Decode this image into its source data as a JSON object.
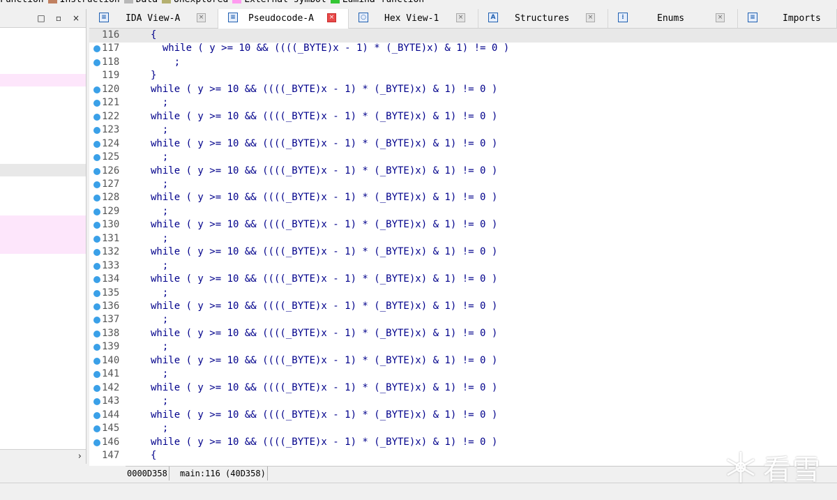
{
  "legend": [
    {
      "label": "Function",
      "color": "#ffffff"
    },
    {
      "label": "Instruction",
      "color": "#c08060"
    },
    {
      "label": "Data",
      "color": "#b8b8b8"
    },
    {
      "label": "Unexplored",
      "color": "#b5b070"
    },
    {
      "label": "External symbol",
      "color": "#ff9bf0"
    },
    {
      "label": "Lumina function",
      "color": "#34c634"
    }
  ],
  "left_panel": {
    "header_buttons": [
      "□",
      "▫",
      "×"
    ],
    "scroll_right": "›"
  },
  "tabs": [
    {
      "label": "IDA View-A",
      "icon": "ida-view-icon",
      "glyph": "≡",
      "active": false
    },
    {
      "label": "Pseudocode-A",
      "icon": "pseudocode-icon",
      "glyph": "≡",
      "active": true
    },
    {
      "label": "Hex View-1",
      "icon": "hex-view-icon",
      "glyph": "○",
      "active": false
    },
    {
      "label": "Structures",
      "icon": "structures-icon",
      "glyph": "A",
      "active": false
    },
    {
      "label": "Enums",
      "icon": "enums-icon",
      "glyph": "⁝",
      "active": false
    },
    {
      "label": "Imports",
      "icon": "imports-icon",
      "glyph": "≡",
      "active": false
    }
  ],
  "code_lines": [
    {
      "num": "116",
      "bp": false,
      "text": "{"
    },
    {
      "num": "117",
      "bp": true,
      "text": "  while ( y >= 10 && ((((_BYTE)x - 1) * (_BYTE)x) & 1) != 0 )"
    },
    {
      "num": "118",
      "bp": true,
      "text": "    ;"
    },
    {
      "num": "119",
      "bp": false,
      "text": "}"
    },
    {
      "num": "120",
      "bp": true,
      "text": "while ( y >= 10 && ((((_BYTE)x - 1) * (_BYTE)x) & 1) != 0 )"
    },
    {
      "num": "121",
      "bp": true,
      "text": "  ;"
    },
    {
      "num": "122",
      "bp": true,
      "text": "while ( y >= 10 && ((((_BYTE)x - 1) * (_BYTE)x) & 1) != 0 )"
    },
    {
      "num": "123",
      "bp": true,
      "text": "  ;"
    },
    {
      "num": "124",
      "bp": true,
      "text": "while ( y >= 10 && ((((_BYTE)x - 1) * (_BYTE)x) & 1) != 0 )"
    },
    {
      "num": "125",
      "bp": true,
      "text": "  ;"
    },
    {
      "num": "126",
      "bp": true,
      "text": "while ( y >= 10 && ((((_BYTE)x - 1) * (_BYTE)x) & 1) != 0 )"
    },
    {
      "num": "127",
      "bp": true,
      "text": "  ;"
    },
    {
      "num": "128",
      "bp": true,
      "text": "while ( y >= 10 && ((((_BYTE)x - 1) * (_BYTE)x) & 1) != 0 )"
    },
    {
      "num": "129",
      "bp": true,
      "text": "  ;"
    },
    {
      "num": "130",
      "bp": true,
      "text": "while ( y >= 10 && ((((_BYTE)x - 1) * (_BYTE)x) & 1) != 0 )"
    },
    {
      "num": "131",
      "bp": true,
      "text": "  ;"
    },
    {
      "num": "132",
      "bp": true,
      "text": "while ( y >= 10 && ((((_BYTE)x - 1) * (_BYTE)x) & 1) != 0 )"
    },
    {
      "num": "133",
      "bp": true,
      "text": "  ;"
    },
    {
      "num": "134",
      "bp": true,
      "text": "while ( y >= 10 && ((((_BYTE)x - 1) * (_BYTE)x) & 1) != 0 )"
    },
    {
      "num": "135",
      "bp": true,
      "text": "  ;"
    },
    {
      "num": "136",
      "bp": true,
      "text": "while ( y >= 10 && ((((_BYTE)x - 1) * (_BYTE)x) & 1) != 0 )"
    },
    {
      "num": "137",
      "bp": true,
      "text": "  ;"
    },
    {
      "num": "138",
      "bp": true,
      "text": "while ( y >= 10 && ((((_BYTE)x - 1) * (_BYTE)x) & 1) != 0 )"
    },
    {
      "num": "139",
      "bp": true,
      "text": "  ;"
    },
    {
      "num": "140",
      "bp": true,
      "text": "while ( y >= 10 && ((((_BYTE)x - 1) * (_BYTE)x) & 1) != 0 )"
    },
    {
      "num": "141",
      "bp": true,
      "text": "  ;"
    },
    {
      "num": "142",
      "bp": true,
      "text": "while ( y >= 10 && ((((_BYTE)x - 1) * (_BYTE)x) & 1) != 0 )"
    },
    {
      "num": "143",
      "bp": true,
      "text": "  ;"
    },
    {
      "num": "144",
      "bp": true,
      "text": "while ( y >= 10 && ((((_BYTE)x - 1) * (_BYTE)x) & 1) != 0 )"
    },
    {
      "num": "145",
      "bp": true,
      "text": "  ;"
    },
    {
      "num": "146",
      "bp": true,
      "text": "while ( y >= 10 && ((((_BYTE)x - 1) * (_BYTE)x) & 1) != 0 )"
    },
    {
      "num": "147",
      "bp": false,
      "text": "{"
    }
  ],
  "status": {
    "offset": "0000D358",
    "location": "main:116 (40D358)"
  },
  "watermark": {
    "text": "看雪"
  },
  "colors": {
    "code_text": "#00008b",
    "breakpoint": "#3aa0e8",
    "current_line": "#e8e8e8",
    "left_highlight": "#fde6fb"
  }
}
